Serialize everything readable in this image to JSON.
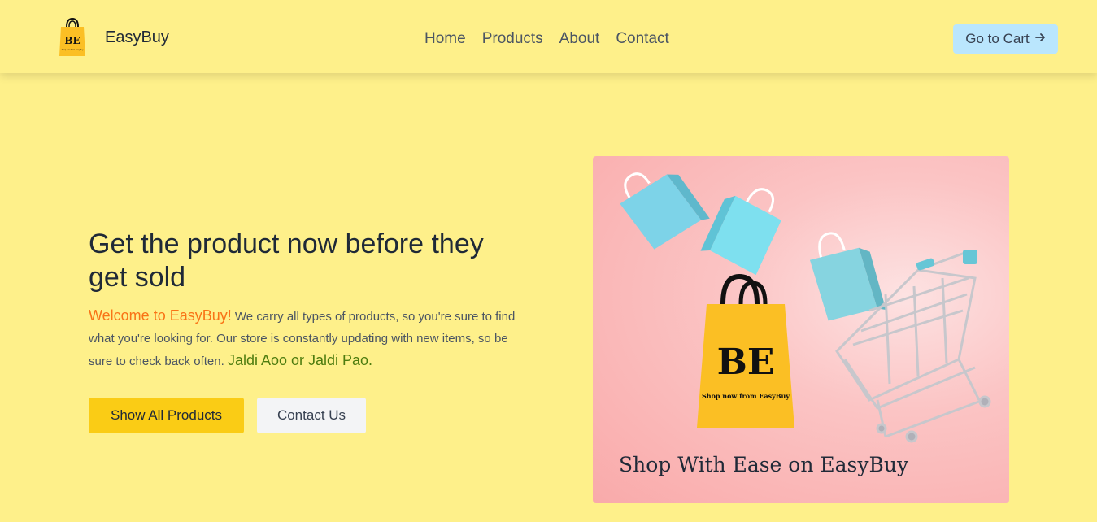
{
  "brand": {
    "name": "EasyBuy",
    "logo_letters": "BE",
    "logo_tagline": "Shop now from EasyBuy"
  },
  "nav": {
    "links": [
      {
        "label": "Home"
      },
      {
        "label": "Products"
      },
      {
        "label": "About"
      },
      {
        "label": "Contact"
      }
    ],
    "cart_button": {
      "label": "Go to Cart",
      "icon": "arrow-right-icon"
    }
  },
  "hero": {
    "title": "Get the product now before they get sold",
    "welcome": "Welcome to EasyBuy!",
    "description": " We carry all types of products, so you're sure to find what you're looking for. Our store is constantly updating with new items, so be sure to check back often. ",
    "tagline": "Jaldi Aoo or Jaldi Pao.",
    "primary_button": "Show All Products",
    "secondary_button": "Contact Us"
  },
  "banner": {
    "bag_letters": "BE",
    "bag_text": "Shop now from EasyBuy",
    "caption": "Shop With Ease on EasyBuy"
  },
  "colors": {
    "background": "#fef08a",
    "accent_orange": "#f97316",
    "accent_green": "#4d7c0f",
    "primary_button": "#facc15",
    "cart_button": "#bae6fd",
    "bag_yellow": "#fbbf24",
    "bag_blue": "#7dd3e8"
  }
}
